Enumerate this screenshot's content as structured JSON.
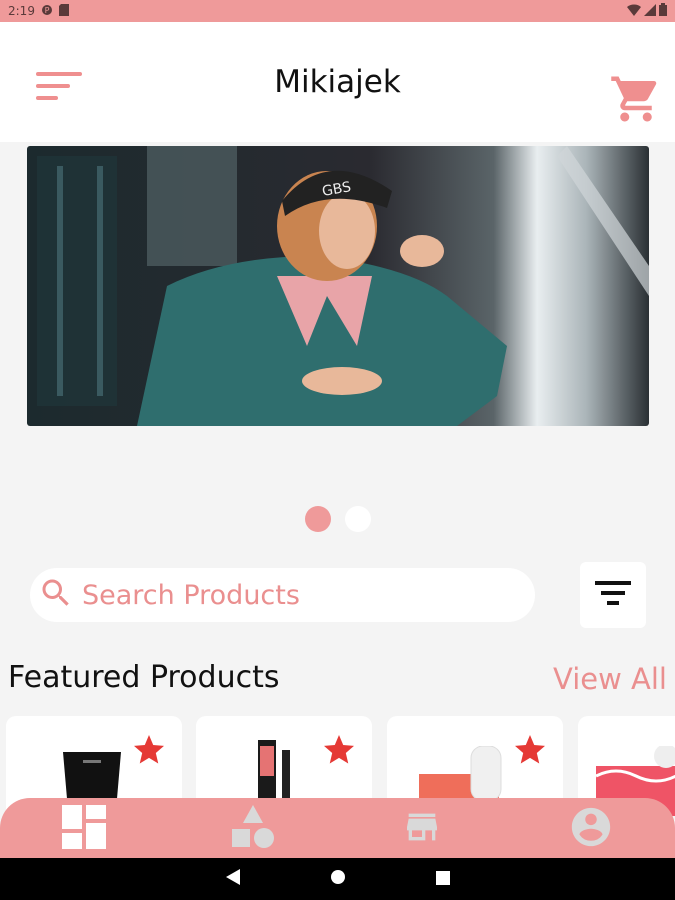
{
  "status_bar": {
    "time": "2:19"
  },
  "app_bar": {
    "title": "Mikiajek"
  },
  "banner": {
    "slides": 2,
    "active_slide": 1,
    "hat_text": "GBS"
  },
  "search": {
    "placeholder": "Search Products"
  },
  "featured": {
    "title": "Featured Products",
    "view_all": "View All",
    "products": [
      {
        "favorited": true
      },
      {
        "favorited": true
      },
      {
        "favorited": true
      },
      {
        "favorited": false
      }
    ]
  },
  "bottom_nav": {
    "items": [
      "dashboard-icon",
      "categories-icon",
      "store-icon",
      "account-icon"
    ],
    "active": 0
  },
  "colors": {
    "accent": "#ef9a9a",
    "star": "#e53935",
    "search_text": "#ea8f8f"
  }
}
